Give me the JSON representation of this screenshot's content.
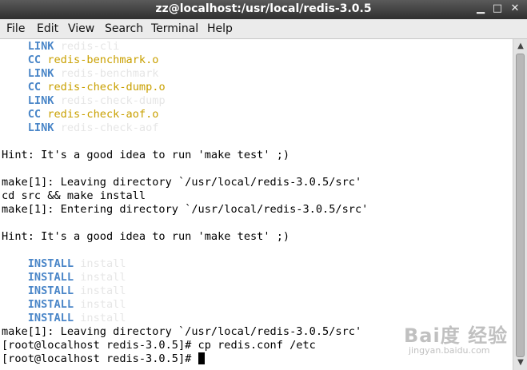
{
  "window": {
    "title": "zz@localhost:/usr/local/redis-3.0.5",
    "minimize_glyph": "▁",
    "maximize_glyph": "□",
    "close_glyph": "✕"
  },
  "menu": {
    "file": "File",
    "edit": "Edit",
    "view": "View",
    "search": "Search",
    "terminal": "Terminal",
    "help": "Help"
  },
  "terminal": {
    "lines": [
      [
        "",
        "    ",
        "LINK",
        " ",
        "redis-cli"
      ],
      [
        "",
        "    ",
        "CC",
        " ",
        "redis-benchmark.o"
      ],
      [
        "",
        "    ",
        "LINK",
        " ",
        "redis-benchmark"
      ],
      [
        "",
        "    ",
        "CC",
        " ",
        "redis-check-dump.o"
      ],
      [
        "",
        "    ",
        "LINK",
        " ",
        "redis-check-dump"
      ],
      [
        "",
        "    ",
        "CC",
        " ",
        "redis-check-aof.o"
      ],
      [
        "",
        "    ",
        "LINK",
        " ",
        "redis-check-aof"
      ],
      [
        ""
      ],
      [
        "Hint: It's a good idea to run 'make test' ;)"
      ],
      [
        ""
      ],
      [
        "make[1]: Leaving directory `/usr/local/redis-3.0.5/src'"
      ],
      [
        "cd src && make install"
      ],
      [
        "make[1]: Entering directory `/usr/local/redis-3.0.5/src'"
      ],
      [
        ""
      ],
      [
        "Hint: It's a good idea to run 'make test' ;)"
      ],
      [
        ""
      ],
      [
        "",
        "    ",
        "INSTALL",
        " ",
        "install"
      ],
      [
        "",
        "    ",
        "INSTALL",
        " ",
        "install"
      ],
      [
        "",
        "    ",
        "INSTALL",
        " ",
        "install"
      ],
      [
        "",
        "    ",
        "INSTALL",
        " ",
        "install"
      ],
      [
        "",
        "    ",
        "INSTALL",
        " ",
        "install"
      ],
      [
        "make[1]: Leaving directory `/usr/local/redis-3.0.5/src'"
      ],
      [
        "[root@localhost redis-3.0.5]# cp redis.conf /etc"
      ],
      [
        "[root@localhost redis-3.0.5]# "
      ]
    ]
  },
  "scrollbar": {
    "up_glyph": "▲",
    "down_glyph": "▼"
  },
  "watermark": {
    "main": "Bai度 经验",
    "sub": "jingyan.baidu.com"
  },
  "colors": {
    "link": "#4a86c8",
    "compile_object": "#c9a000",
    "dim_target": "#e6e6e6"
  }
}
